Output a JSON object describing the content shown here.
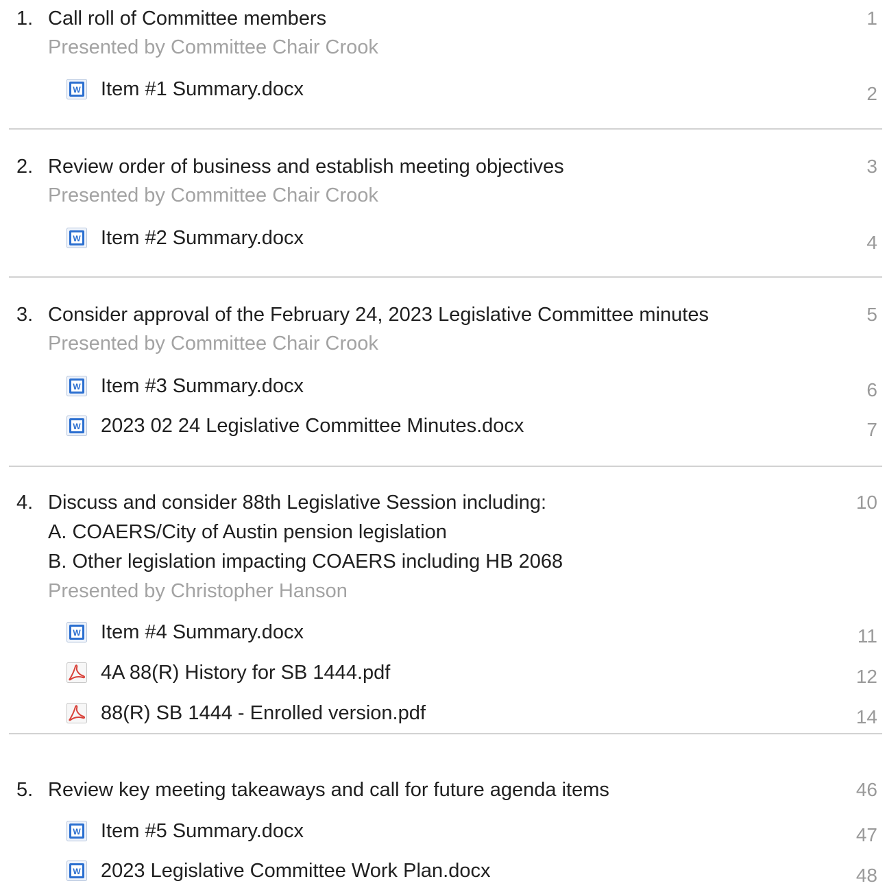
{
  "items": [
    {
      "number": "1.",
      "title": "Call roll of Committee members",
      "presenter": "Presented by Committee Chair Crook",
      "page": "1",
      "docs": [
        {
          "name": "Item #1 Summary.docx",
          "icon": "word-document-icon",
          "page": "2"
        }
      ]
    },
    {
      "number": "2.",
      "title": "Review order of business and establish meeting objectives",
      "presenter": "Presented by Committee Chair Crook",
      "page": "3",
      "docs": [
        {
          "name": "Item #2 Summary.docx",
          "icon": "word-document-icon",
          "page": "4"
        }
      ]
    },
    {
      "number": "3.",
      "title": "Consider approval of the February 24, 2023 Legislative Committee minutes",
      "presenter": "Presented by Committee Chair Crook",
      "page": "5",
      "docs": [
        {
          "name": "Item #3 Summary.docx",
          "icon": "word-document-icon",
          "page": "6"
        },
        {
          "name": "2023 02 24 Legislative Committee Minutes.docx",
          "icon": "word-document-icon",
          "page": "7"
        }
      ]
    },
    {
      "number": "4.",
      "title": "Discuss and consider 88th Legislative Session including:",
      "sublines": [
        "A. COAERS/City of Austin pension legislation",
        "B. Other legislation impacting COAERS including HB 2068"
      ],
      "presenter": "Presented by Christopher Hanson",
      "page": "10",
      "docs": [
        {
          "name": "Item #4 Summary.docx",
          "icon": "word-document-icon",
          "page": "11"
        },
        {
          "name": "4A 88(R) History for SB 1444.pdf",
          "icon": "pdf-document-icon",
          "page": "12"
        },
        {
          "name": "88(R) SB 1444 - Enrolled version.pdf",
          "icon": "pdf-document-icon",
          "page": "14"
        }
      ]
    },
    {
      "number": "5.",
      "title": "Review key meeting takeaways and call for future agenda items",
      "page": "46",
      "docs": [
        {
          "name": "Item #5 Summary.docx",
          "icon": "word-document-icon",
          "page": "47"
        },
        {
          "name": "2023 Legislative Committee Work Plan.docx",
          "icon": "word-document-icon",
          "page": "48"
        }
      ]
    }
  ],
  "colors": {
    "text": "#202020",
    "muted": "#a3a3a3",
    "separator": "#d2d2d2",
    "word_blue": "#2b6fd0",
    "pdf_red": "#d9423a"
  }
}
